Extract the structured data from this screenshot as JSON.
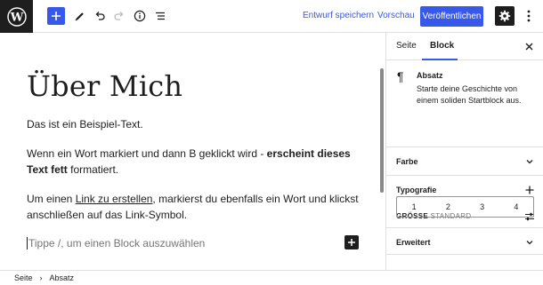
{
  "toolbar": {
    "save_draft": "Entwurf speichern",
    "preview": "Vorschau",
    "publish": "Veröffentlichen"
  },
  "editor": {
    "title": "Über Mich",
    "p1": "Das ist ein Beispiel-Text.",
    "p2_start": "Wenn ein Wort markiert und dann B geklickt wird - ",
    "p2_bold": "erscheint dieses Text fett",
    "p2_end": " formatiert.",
    "p3_start": "Um einen ",
    "p3_link": "Link zu erstellen",
    "p3_end": ", markierst du ebenfalls ein Wort und klickst anschließen auf das Link-Symbol.",
    "placeholder": "Tippe /, um einen Block auszuwählen"
  },
  "sidebar": {
    "tab_page": "Seite",
    "tab_block": "Block",
    "block_name": "Absatz",
    "block_desc": "Starte deine Geschichte von einem soliden Startblock aus.",
    "color_panel": "Farbe",
    "typography_panel": "Typografie",
    "size_label": "GRÖSSE",
    "size_value": "STANDARD",
    "size_options": [
      "1",
      "2",
      "3",
      "4"
    ],
    "advanced_panel": "Erweitert"
  },
  "footer": {
    "crumb_1": "Seite",
    "crumb_2": "Absatz"
  },
  "colors": {
    "accent": "#3858e9",
    "dark": "#1e1e1e",
    "border": "#e0e0e0"
  }
}
